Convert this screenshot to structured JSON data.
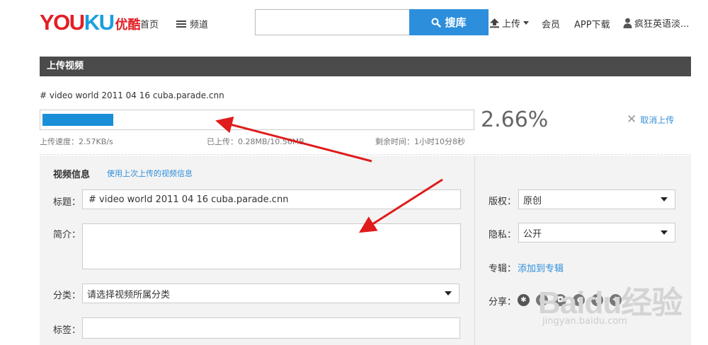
{
  "header": {
    "logo_text_a": "YOU",
    "logo_text_b": "KU",
    "logo_cn": "优酷",
    "nav_home": "首页",
    "nav_channel": "频道",
    "search_placeholder": "",
    "search_button": "搜库",
    "upload": "上传",
    "member": "会员",
    "app_download": "APP下载",
    "user_name": "疯狂英语淡..."
  },
  "page_title": "上传视频",
  "upload": {
    "file_name": "# video world 2011 04 16 cuba.parade.cnn",
    "progress_fraction": 0.0266,
    "percent_text": "2.66%",
    "cancel_label": "取消上传",
    "speed": "上传速度：2.57KB/s",
    "uploaded": "已上传：0.28MB/10.56MB",
    "remaining": "剩余时间：1小时10分8秒"
  },
  "form": {
    "info_heading": "视频信息",
    "use_last_link": "使用上次上传的视频信息",
    "title_label": "标题：",
    "title_value": "# video world 2011 04 16 cuba.parade.cnn",
    "intro_label": "简介：",
    "intro_value": "",
    "category_label": "分类：",
    "category_value": "请选择视频所属分类",
    "tags_label": "标签：",
    "tags_value": ""
  },
  "side": {
    "copyright_label": "版权：",
    "copyright_value": "原创",
    "privacy_label": "隐私：",
    "privacy_value": "公开",
    "album_label": "专辑：",
    "album_link": "添加到专辑",
    "share_label": "分享："
  },
  "watermark": {
    "brand": "Baidu经验",
    "url": "jingyan.baidu.com"
  },
  "colors": {
    "brand_red": "#e31f26",
    "brand_blue": "#1a9fe0",
    "search_blue": "#2d8fdc",
    "progress_blue": "#1a8fd8",
    "bar_gray": "#4b4b4b",
    "annotation_red": "#e01b1b"
  }
}
